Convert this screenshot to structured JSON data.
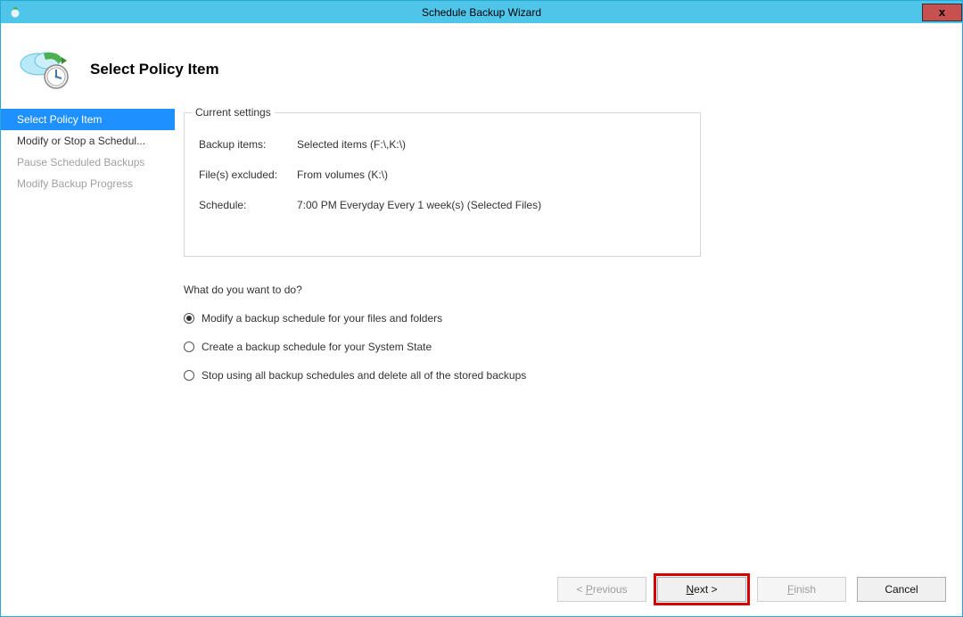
{
  "titlebar": {
    "title": "Schedule Backup Wizard",
    "close": "x"
  },
  "header": {
    "title": "Select Policy Item"
  },
  "nav": {
    "items": [
      {
        "label": "Select Policy Item",
        "selected": true,
        "enabled": true
      },
      {
        "label": "Modify or Stop a Schedul...",
        "selected": false,
        "enabled": true
      },
      {
        "label": "Pause Scheduled Backups",
        "selected": false,
        "enabled": false
      },
      {
        "label": "Modify Backup Progress",
        "selected": false,
        "enabled": false
      }
    ]
  },
  "settings": {
    "title": "Current settings",
    "rows": {
      "backup_items_label": "Backup items:",
      "backup_items_value": "Selected items (F:\\,K:\\)",
      "files_excluded_label": "File(s) excluded:",
      "files_excluded_value": "From volumes (K:\\)",
      "schedule_label": "Schedule:",
      "schedule_value": "7:00 PM Everyday Every 1 week(s) (Selected Files)"
    }
  },
  "question": "What do you want to do?",
  "options": {
    "modify": "Modify a backup schedule for your files and folders",
    "create": "Create a backup schedule for your System State",
    "stop": "Stop using all backup schedules and delete all of the stored backups"
  },
  "footer": {
    "previous": "< Previous",
    "next": "Next >",
    "finish": "Finish",
    "cancel": "Cancel"
  }
}
